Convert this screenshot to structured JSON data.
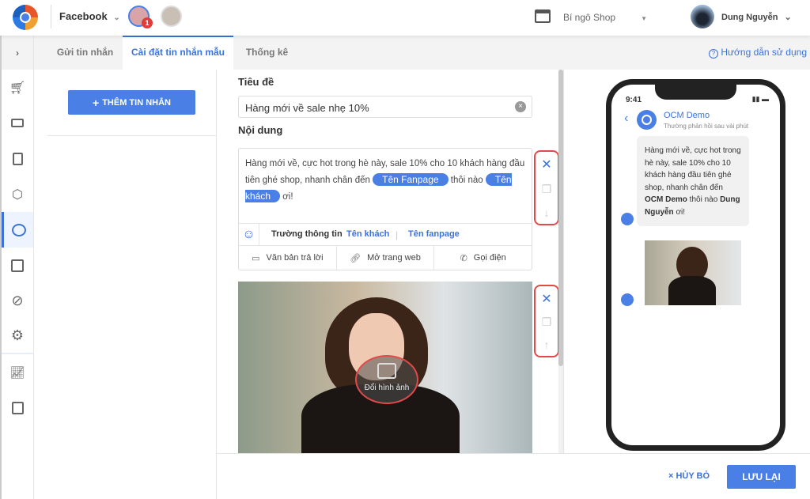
{
  "topbar": {
    "platform": "Facebook",
    "badge_count": "1",
    "shop_name": "Bí ngô Shop",
    "user_name": "Dung Nguyễn"
  },
  "tabs": [
    {
      "label": "Gửi tin nhắn"
    },
    {
      "label": "Cài đặt tin nhắn mẫu"
    },
    {
      "label": "Thống kê"
    }
  ],
  "help_link": "Hướng dẫn sử dụng",
  "left": {
    "add_button": "THÊM TIN NHẮN"
  },
  "editor": {
    "title_label": "Tiêu đề",
    "title_value": "Hàng mới về sale nhẹ 10%",
    "content_label": "Nội dung",
    "content_text_1": "Hàng mới về, cực hot trong hè này, sale 10% cho 10 khách hàng đầu tiên ghé shop, nhanh chân đến",
    "chip_fanpage": "Tên Fanpage",
    "content_text_2": "thôi nào",
    "chip_customer": "Tên khách",
    "content_text_3": "ơi!",
    "fields_label": "Trường thông tin",
    "field_customer": "Tên khách",
    "field_fanpage": "Tên fanpage",
    "buttons": [
      {
        "label": "Văn bản trả lời"
      },
      {
        "label": "Mở trang web"
      },
      {
        "label": "Gọi điện"
      }
    ],
    "change_image": "Đổi hình ảnh"
  },
  "preview": {
    "time": "9:41",
    "page_name": "OCM Demo",
    "status": "Thường phản hồi sau vài phút",
    "msg_1": "Hàng mới về, cực hot trong hè này, sale 10% cho 10 khách hàng đầu tiên ghé shop, nhanh chân đến ",
    "msg_bold_1": "OCM Demo",
    "msg_2": " thôi nào ",
    "msg_bold_2": "Dung Nguyễn",
    "msg_3": " ơi!"
  },
  "footer": {
    "cancel": "× HỦY BỎ",
    "save": "LƯU LẠI"
  },
  "colors": {
    "accent": "#4a7fe6",
    "danger": "#e24a4a"
  }
}
